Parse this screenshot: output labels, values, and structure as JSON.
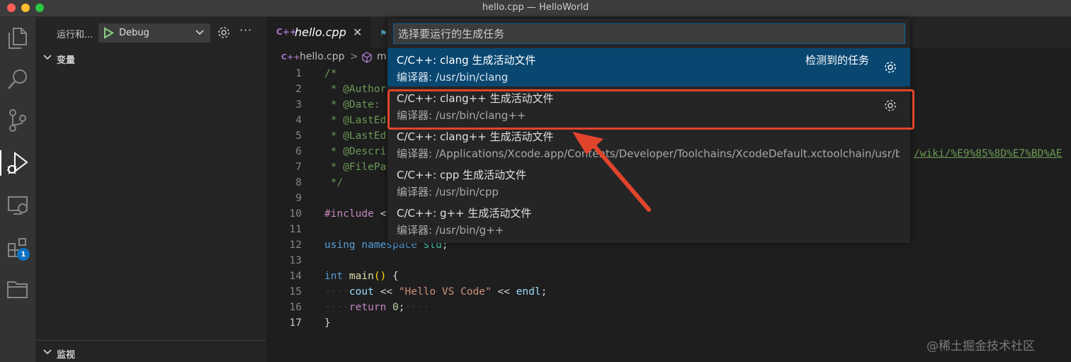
{
  "window": {
    "title": "hello.cpp — HelloWorld"
  },
  "activity": {
    "extensions_badge": "1"
  },
  "sidebar": {
    "run_title": "运行和...",
    "config_select": "Debug",
    "sections": {
      "variables": "变量",
      "watch": "监视"
    }
  },
  "editor": {
    "tab": {
      "icon_text": "C++",
      "label": "hello.cpp"
    },
    "breadcrumb": {
      "icon_text": "C++",
      "file": "hello.cpp",
      "separator": ">",
      "symbol": "m"
    },
    "lines": [
      "1",
      "2",
      "3",
      "4",
      "5",
      "6",
      "7",
      "8",
      "9",
      "10",
      "11",
      "12",
      "13",
      "14",
      "15",
      "16",
      "17"
    ],
    "code": {
      "l1": "/*",
      "l2_star": " * ",
      "l2": "@Author",
      "l3_star": " * ",
      "l3": "@Date:",
      "l4_star": " * ",
      "l4": "@LastEd",
      "l5_star": " * ",
      "l5": "@LastEd",
      "l6_star": " * ",
      "l6": "@Descri",
      "l7_star": " * ",
      "l7": "@FilePa",
      "l8": " */",
      "l10_pp": "#include",
      "l10_rest": " <",
      "l12_kw1": "using",
      "l12_kw2": " namespace",
      "l12_ns": " std",
      "l12_end": ";",
      "l14_kw": "int",
      "l14_fn": " main",
      "l14_par": "()",
      "l14_brace": " {",
      "l15_var": "cout",
      "l15_op1": " << ",
      "l15_str": "\"Hello VS Code\"",
      "l15_op2": " << ",
      "l15_var2": "endl",
      "l15_end": ";",
      "l16_kw": "return",
      "l16_num": " 0",
      "l16_end": ";",
      "l17": "}",
      "l6_link": "/wiki/%E9%85%8D%E7%BD%AE"
    }
  },
  "quickpick": {
    "placeholder": "选择要运行的生成任务",
    "items": [
      {
        "label": "C/C++: clang 生成活动文件",
        "detail": "编译器: /usr/bin/clang",
        "group": "检测到的任务"
      },
      {
        "label": "C/C++: clang++ 生成活动文件",
        "detail": "编译器: /usr/bin/clang++"
      },
      {
        "label": "C/C++: clang++ 生成活动文件",
        "detail": "编译器: /Applications/Xcode.app/Contents/Developer/Toolchains/XcodeDefault.xctoolchain/usr/b..."
      },
      {
        "label": "C/C++: cpp 生成活动文件",
        "detail": "编译器: /usr/bin/cpp"
      },
      {
        "label": "C/C++: g++ 生成活动文件",
        "detail": "编译器: /usr/bin/g++"
      }
    ]
  },
  "watermark": "@稀土掘金技术社区",
  "colors": {
    "accent": "#0e639c",
    "selection": "#094771",
    "highlight": "#e1442b"
  }
}
